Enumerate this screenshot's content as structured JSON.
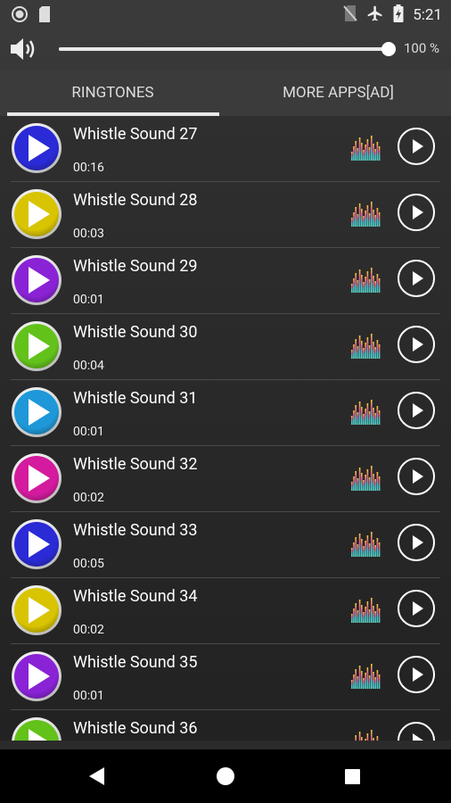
{
  "status_bar": {
    "time": "5:21",
    "icons": [
      "circle-notification-icon",
      "sd-card-icon",
      "no-sim-icon",
      "airplane-mode-icon",
      "battery-charging-icon"
    ]
  },
  "volume": {
    "percent": 100,
    "label": "100 %"
  },
  "tabs": [
    {
      "label": "RINGTONES",
      "active": true
    },
    {
      "label": "MORE APPS[AD]",
      "active": false
    }
  ],
  "ringtones": [
    {
      "name": "Whistle Sound 27",
      "duration": "00:16",
      "color": "#2a2ad6"
    },
    {
      "name": "Whistle Sound 28",
      "duration": "00:03",
      "color": "#d8c400"
    },
    {
      "name": "Whistle Sound 29",
      "duration": "00:01",
      "color": "#8a22d6"
    },
    {
      "name": "Whistle Sound 30",
      "duration": "00:04",
      "color": "#62c21a"
    },
    {
      "name": "Whistle Sound 31",
      "duration": "00:01",
      "color": "#1e98d8"
    },
    {
      "name": "Whistle Sound 32",
      "duration": "00:02",
      "color": "#d41a9e"
    },
    {
      "name": "Whistle Sound 33",
      "duration": "00:05",
      "color": "#2a2ad6"
    },
    {
      "name": "Whistle Sound 34",
      "duration": "00:02",
      "color": "#d8c400"
    },
    {
      "name": "Whistle Sound 35",
      "duration": "00:01",
      "color": "#8a22d6"
    },
    {
      "name": "Whistle Sound 36",
      "duration": "",
      "color": "#62c21a"
    }
  ]
}
